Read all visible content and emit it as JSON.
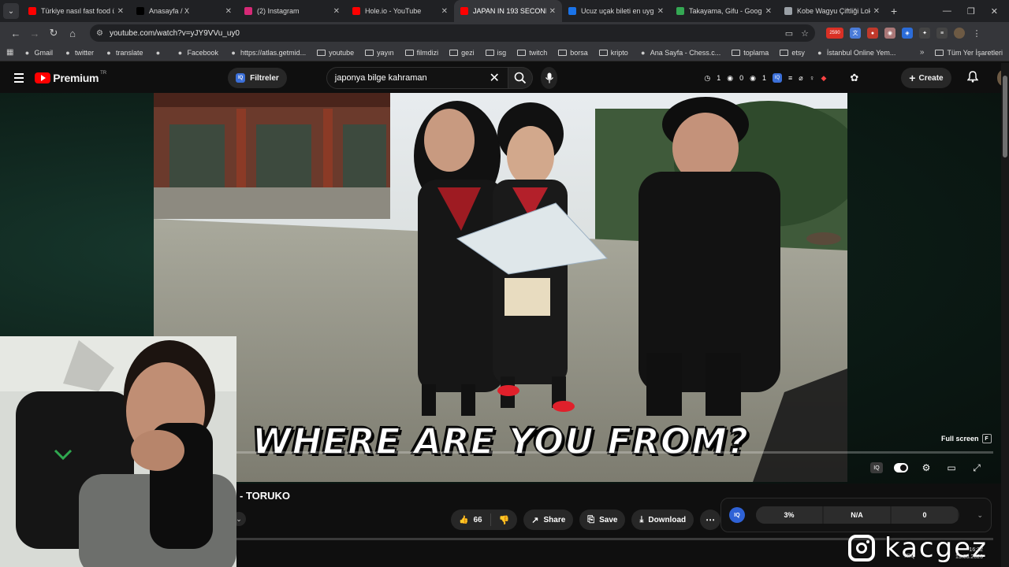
{
  "browser": {
    "tabs": [
      {
        "title": "Türkiye nasıl fast food ülk",
        "favicon_color": "#ff0000",
        "active": false
      },
      {
        "title": "Anasayfa / X",
        "favicon_color": "#000000",
        "active": false
      },
      {
        "title": "(2) Instagram",
        "favicon_color": "#d62976",
        "active": false
      },
      {
        "title": "Hole.io - YouTube",
        "favicon_color": "#ff0000",
        "active": false
      },
      {
        "title": "JAPAN IN 193 SECONDS",
        "favicon_color": "#ff0000",
        "active": true
      },
      {
        "title": "Ucuz uçak bileti en uygun",
        "favicon_color": "#1a73e8",
        "active": false
      },
      {
        "title": "Takayama, Gifu - Google",
        "favicon_color": "#34a853",
        "active": false
      },
      {
        "title": "Kobe Wagyu Çiftliği Loka",
        "favicon_color": "#9aa0a6",
        "active": false
      }
    ],
    "url": "youtube.com/watch?v=yJY9VVu_uy0",
    "extension_badge": "2590"
  },
  "bookmarks": {
    "items": [
      {
        "label": "Gmail",
        "type": "site"
      },
      {
        "label": "twitter",
        "type": "site"
      },
      {
        "label": "translate",
        "type": "site"
      },
      {
        "label": "",
        "type": "site"
      },
      {
        "label": "Facebook",
        "type": "site"
      },
      {
        "label": "https://atlas.getmid...",
        "type": "site"
      },
      {
        "label": "youtube",
        "type": "folder"
      },
      {
        "label": "yayın",
        "type": "folder"
      },
      {
        "label": "filmdizi",
        "type": "folder"
      },
      {
        "label": "gezi",
        "type": "folder"
      },
      {
        "label": "isg",
        "type": "folder"
      },
      {
        "label": "twitch",
        "type": "folder"
      },
      {
        "label": "borsa",
        "type": "folder"
      },
      {
        "label": "kripto",
        "type": "folder"
      },
      {
        "label": "Ana Sayfa - Chess.c...",
        "type": "site"
      },
      {
        "label": "toplama",
        "type": "folder"
      },
      {
        "label": "etsy",
        "type": "folder"
      },
      {
        "label": "İstanbul Online Yem...",
        "type": "site"
      }
    ],
    "all_bookmarks": "Tüm Yer İşaretleri"
  },
  "youtube": {
    "logo_text": "Premium",
    "region": "TR",
    "filters_label": "Filtreler",
    "search_query": "japonya bilge kahraman",
    "stats": [
      "1",
      "0",
      "1"
    ],
    "create_label": "Create"
  },
  "player": {
    "subtitle": "WHERE ARE YOU FROM?",
    "fullscreen_tip": "Full screen",
    "fullscreen_key": "F"
  },
  "video": {
    "title_fragment": "- TORUKO",
    "likes": "66",
    "share_label": "Share",
    "save_label": "Save",
    "download_label": "Download"
  },
  "iq_panel": {
    "logo": "IQ",
    "values": [
      "3%",
      "N/A",
      "0"
    ]
  },
  "overlay": {
    "watermark": "kacgez"
  },
  "taskbar": {
    "lang": "TRQ",
    "time": "16:22",
    "date": "15.08.2026"
  }
}
